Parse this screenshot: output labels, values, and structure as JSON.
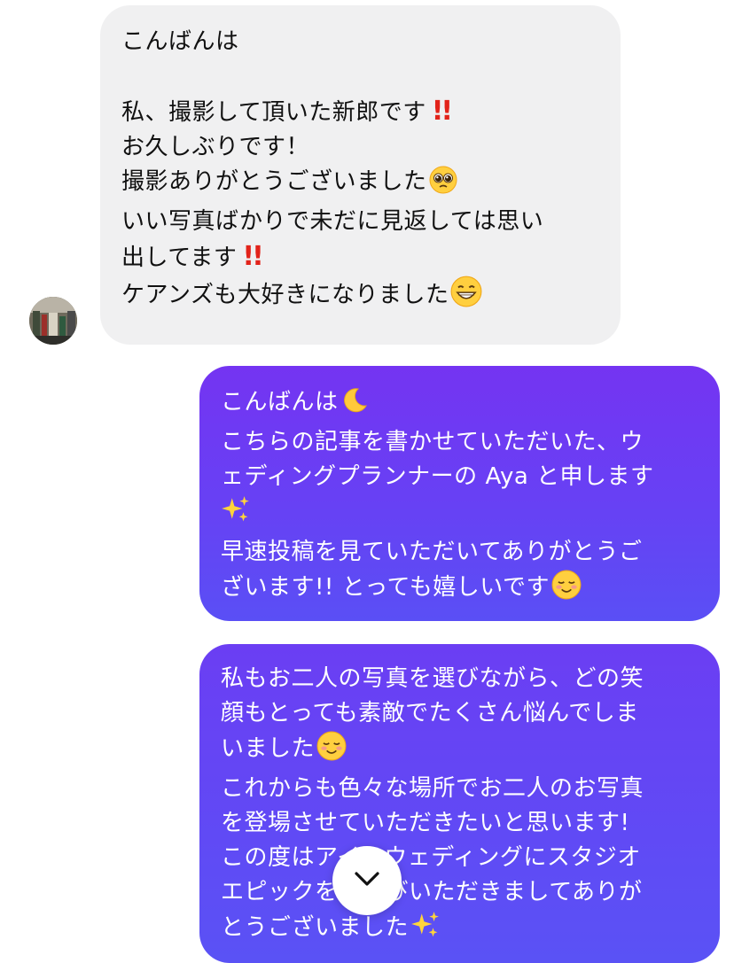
{
  "incoming_message": {
    "lines": [
      "こんばんは",
      "",
      "私、撮影して頂いた新郎です",
      "お久しぶりです！",
      "撮影ありがとうございました",
      "いい写真ばかりで未だに見返しては思い",
      "出してます",
      "ケアンズも大好きになりました"
    ],
    "emoji": {
      "line3": "double-exclamation-icon",
      "line5": "pleading-face-icon",
      "line7": "double-exclamation-icon",
      "line8": "grinning-face-icon"
    }
  },
  "outgoing_message_1": {
    "lines": [
      "こんばんは",
      "こちらの記事を書かせていただいた、ウ",
      "ェディングプランナーの Aya と申します",
      "",
      "早速投稿を見ていただいてありがとうご",
      "ざいます!! とっても嬉しいです"
    ],
    "emoji": {
      "line1": "crescent-moon-icon",
      "line4": "sparkles-icon",
      "line6": "smiling-face-icon"
    }
  },
  "outgoing_message_2": {
    "lines": [
      "私もお二人の写真を選びながら、どの笑",
      "顔もとっても素敵でたくさん悩んでしま",
      "いました",
      "これからも色々な場所でお二人のお写真",
      "を登場させていただきたいと思います!",
      "この度はアイ・ウェディングにスタジオ",
      "エピックをお選びいただきましてありが",
      "とうございました"
    ],
    "emoji": {
      "line3": "smiling-face-icon",
      "line8": "sparkles-icon"
    }
  },
  "controls": {
    "scroll_down_icon": "chevron-down-icon"
  },
  "colors": {
    "incoming_bubble": "#f0f0f1",
    "outgoing_gradient_top": "#7434f2",
    "outgoing_gradient_bottom": "#5a52f5",
    "exclamation_red": "#e2231a"
  }
}
